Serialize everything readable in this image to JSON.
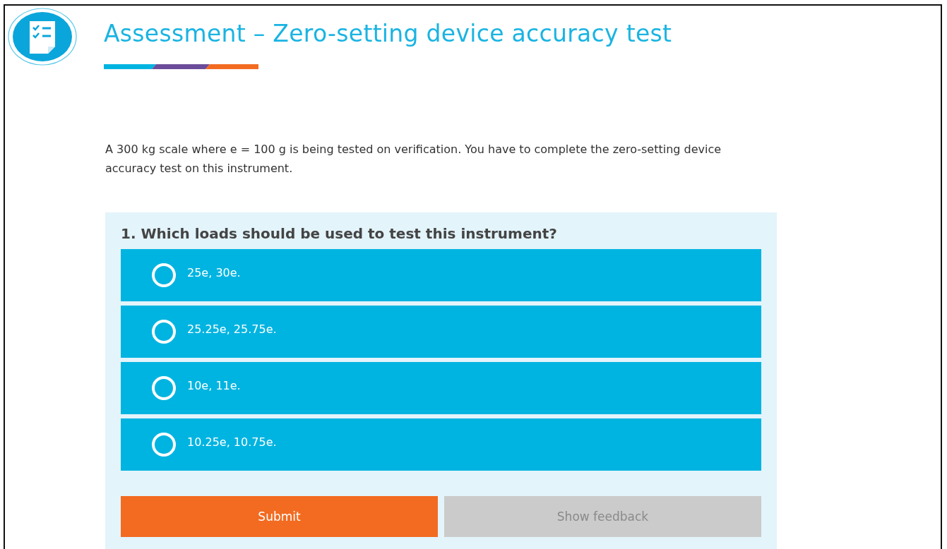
{
  "header": {
    "title": "Assessment – Zero-setting device accuracy test"
  },
  "intro": "A 300 kg scale where e = 100 g is being tested on verification. You have to complete the zero-setting device accuracy test on this instrument.",
  "question": {
    "title": "1. Which loads should be used to test this instrument?",
    "options": [
      {
        "label": "25e, 30e.",
        "selected": false
      },
      {
        "label": "25.25e, 25.75e.",
        "selected": false
      },
      {
        "label": "10e, 11e.",
        "selected": false
      },
      {
        "label": "10.25e, 10.75e.",
        "selected": false
      }
    ]
  },
  "buttons": [
    {
      "label": "Submit",
      "kind": "primary",
      "disabled": false
    },
    {
      "label": "Show feedback",
      "kind": "secondary",
      "disabled": true
    }
  ]
}
